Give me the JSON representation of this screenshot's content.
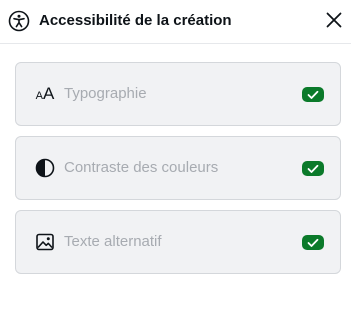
{
  "header": {
    "title": "Accessibilité de la création",
    "icon": "accessibility-icon",
    "close_icon": "close-icon"
  },
  "checks": [
    {
      "label": "Typographie",
      "icon": "typography-icon",
      "status": "passed"
    },
    {
      "label": "Contraste des couleurs",
      "icon": "contrast-icon",
      "status": "passed"
    },
    {
      "label": "Texte alternatif",
      "icon": "image-icon",
      "status": "passed"
    }
  ],
  "colors": {
    "success": "#0b7a2a",
    "card_bg": "#f1f2f4",
    "card_border": "#d4d7db",
    "label_text": "#a7abb1",
    "title_text": "#0e1318"
  },
  "icons": {
    "typography_glyph_small": "A",
    "typography_glyph_big": "A"
  }
}
